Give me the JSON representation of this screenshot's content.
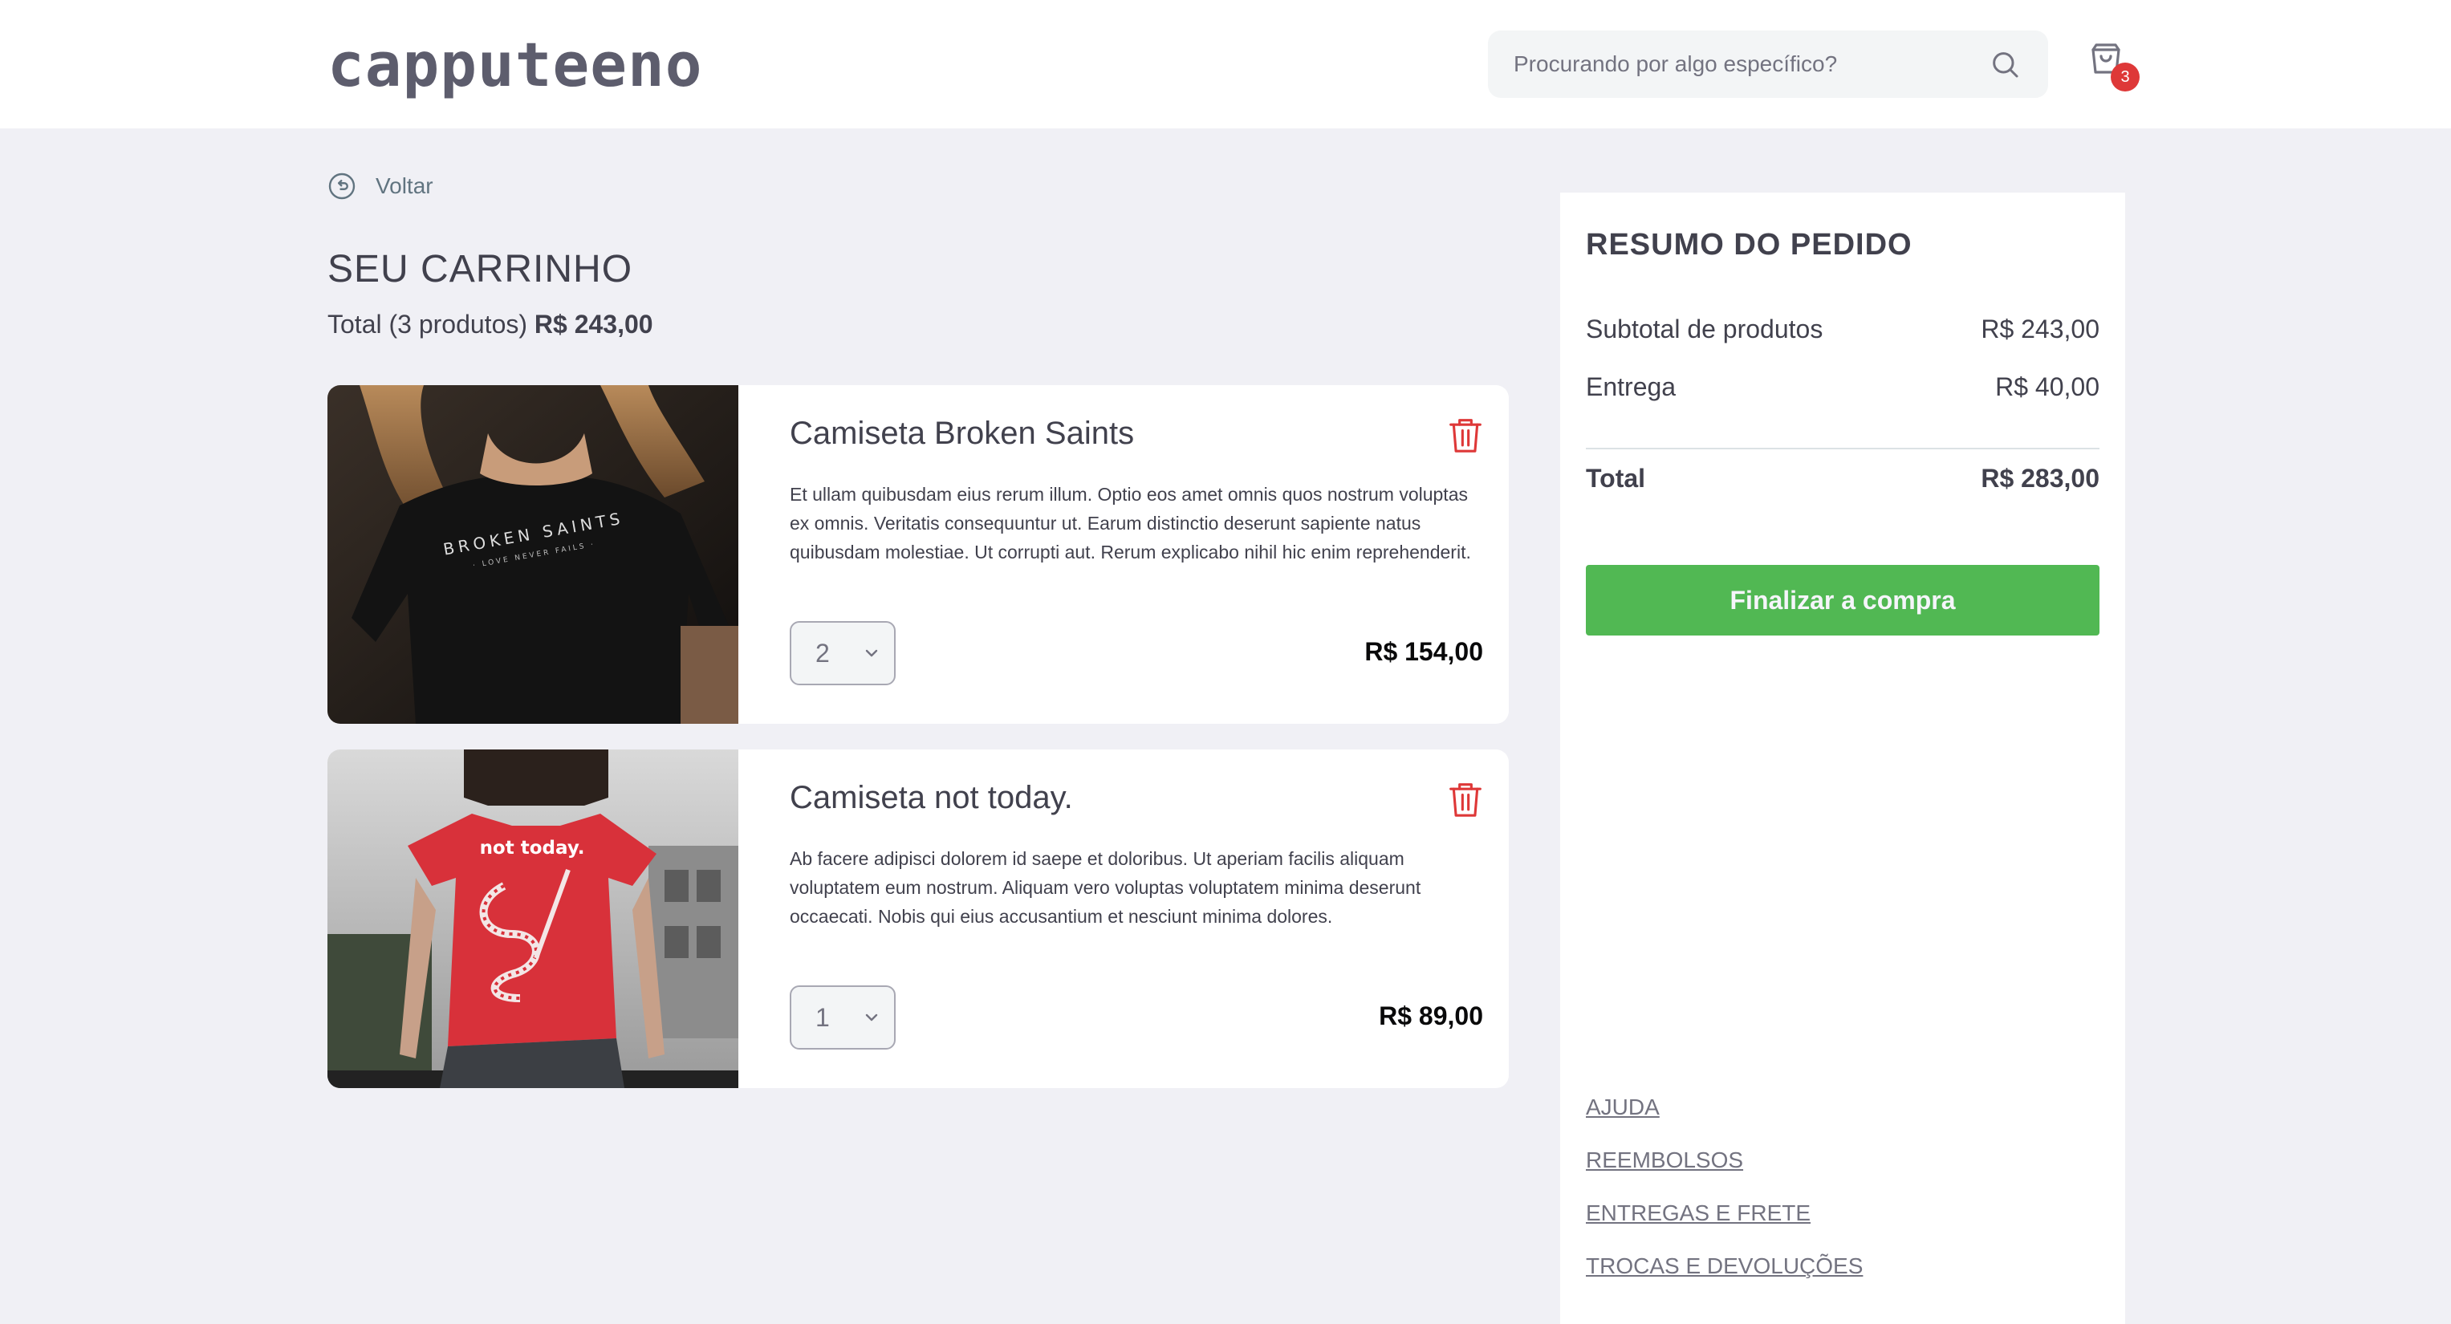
{
  "header": {
    "logo": "capputeeno",
    "search_placeholder": "Procurando por algo específico?",
    "cart_count": "3"
  },
  "page": {
    "back_label": "Voltar",
    "title": "SEU CARRINHO",
    "total_prefix": "Total (3 produtos)",
    "total_value": "R$ 243,00"
  },
  "products": [
    {
      "name": "Camiseta Broken Saints",
      "description": "Et ullam quibusdam eius rerum illum. Optio eos amet omnis quos nostrum voluptas ex omnis. Veritatis consequuntur ut. Earum distinctio deserunt sapiente natus quibusdam molestiae. Ut corrupti aut. Rerum explicabo nihil hic enim reprehenderit.",
      "quantity": "2",
      "price": "R$ 154,00",
      "image_text": "BROKEN SAINTS",
      "image_subtext": "· LOVE NEVER FAILS ·"
    },
    {
      "name": "Camiseta not today.",
      "description": "Ab facere adipisci dolorem id saepe et doloribus. Ut aperiam facilis aliquam voluptatem eum nostrum. Aliquam vero voluptas voluptatem minima deserunt occaecati. Nobis qui eius accusantium et nesciunt minima dolores.",
      "quantity": "1",
      "price": "R$ 89,00",
      "image_text": "not today."
    }
  ],
  "summary": {
    "title": "RESUMO DO PEDIDO",
    "subtotal_label": "Subtotal de produtos",
    "subtotal_value": "R$ 243,00",
    "shipping_label": "Entrega",
    "shipping_value": "R$ 40,00",
    "total_label": "Total",
    "total_value": "R$ 283,00",
    "checkout_label": "Finalizar a compra"
  },
  "links": [
    "AJUDA",
    "REEMBOLSOS",
    "ENTREGAS E FRETE",
    "TROCAS E DEVOLUÇÕES"
  ],
  "colors": {
    "background": "#f0f0f5",
    "checkout": "#51b853",
    "badge": "#de3838",
    "delete": "#de3838"
  },
  "icons": [
    "search-icon",
    "shopping-bag-icon",
    "back-arrow-icon",
    "trash-icon",
    "chevron-down-icon"
  ]
}
